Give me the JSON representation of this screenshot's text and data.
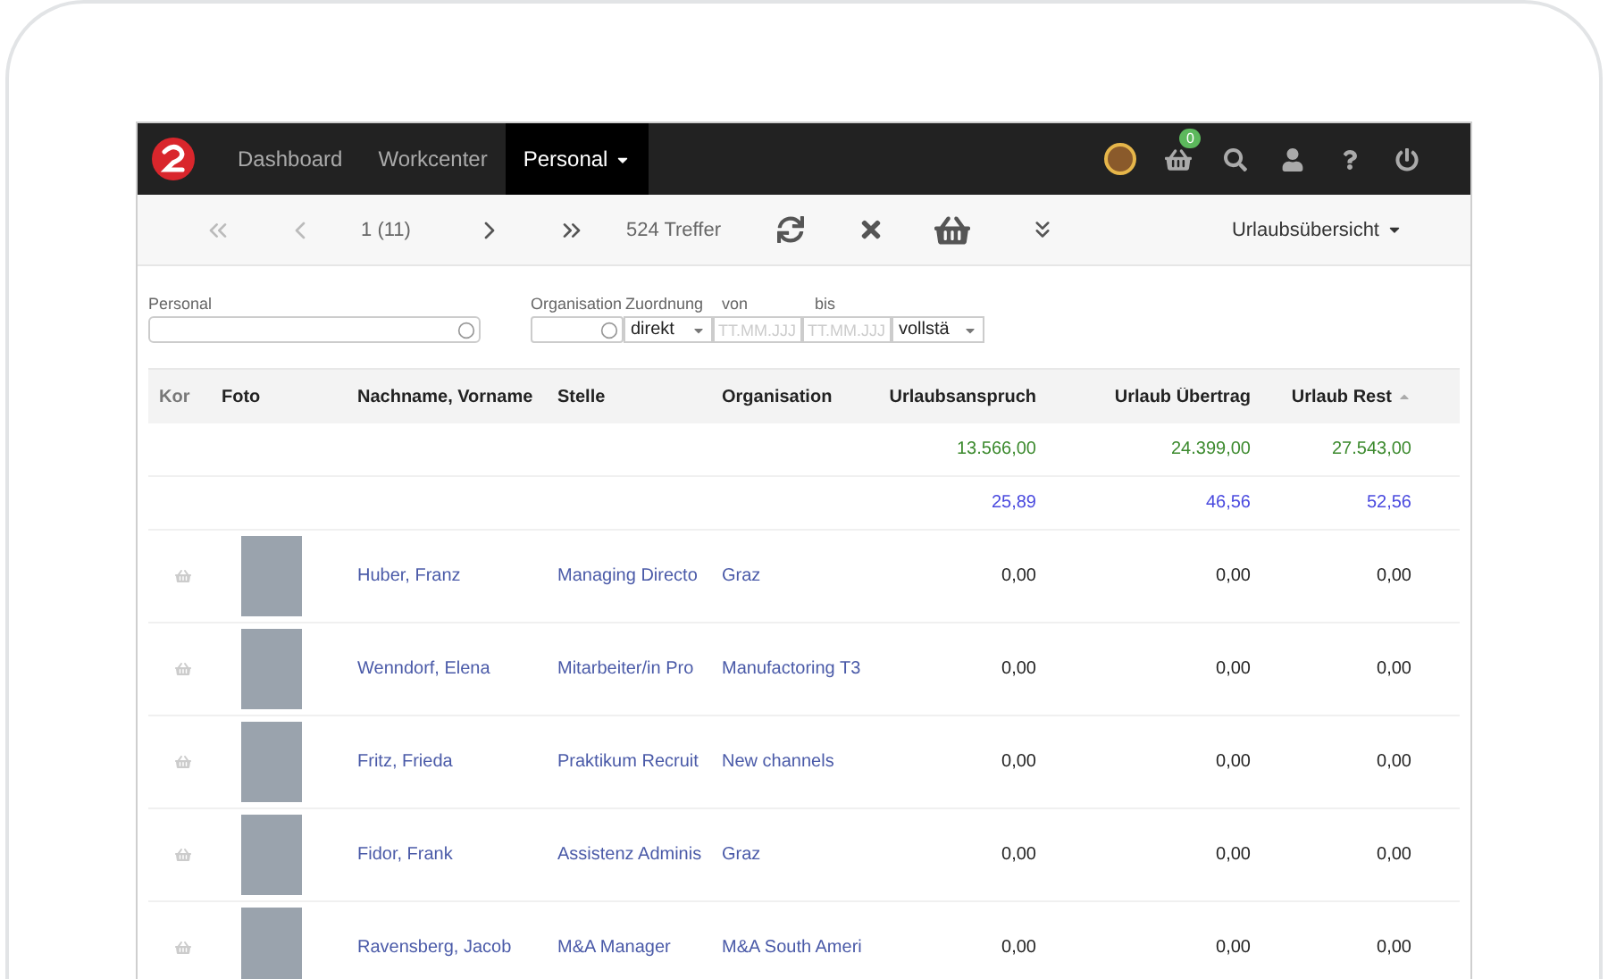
{
  "nav": {
    "items": [
      {
        "label": "Dashboard",
        "selected": false,
        "dropdown": false
      },
      {
        "label": "Workcenter",
        "selected": false,
        "dropdown": false
      },
      {
        "label": "Personal",
        "selected": true,
        "dropdown": true
      }
    ],
    "cart_count": "0"
  },
  "toolbar": {
    "page": "1 (11)",
    "hits": "524 Treffer",
    "view": "Urlaubsübersicht"
  },
  "filters": {
    "personal": {
      "label": "Personal"
    },
    "organisation": {
      "label": "Organisation"
    },
    "zuordnung": {
      "label": "Zuordnung",
      "value": "direkt"
    },
    "von": {
      "label": "von",
      "placeholder": "TT.MM.JJJ"
    },
    "bis": {
      "label": "bis",
      "placeholder": "TT.MM.JJJ"
    },
    "umfang": {
      "value": "vollstä"
    }
  },
  "table": {
    "columns": [
      {
        "label": "Kor",
        "sorted": false
      },
      {
        "label": "Foto",
        "sorted": false
      },
      {
        "label": "Nachname, Vorname",
        "sorted": false
      },
      {
        "label": "Stelle",
        "sorted": false
      },
      {
        "label": "Organisation",
        "sorted": false
      },
      {
        "label": "Urlaubsanspruch",
        "sorted": false
      },
      {
        "label": "Urlaub Übertrag",
        "sorted": false
      },
      {
        "label": "Urlaub Rest",
        "sorted": true
      }
    ],
    "totals": [
      {
        "kind": "sum",
        "values": [
          "13.566,00",
          "24.399,00",
          "27.543,00"
        ]
      },
      {
        "kind": "average",
        "values": [
          "25,89",
          "46,56",
          "52,56"
        ]
      }
    ],
    "rows": [
      {
        "name": "Huber, Franz",
        "position": "Managing Directo",
        "organisation": "Graz",
        "values": [
          "0,00",
          "0,00",
          "0,00"
        ]
      },
      {
        "name": "Wenndorf, Elena",
        "position": "Mitarbeiter/in Pro",
        "organisation": "Manufactoring T3",
        "values": [
          "0,00",
          "0,00",
          "0,00"
        ]
      },
      {
        "name": "Fritz, Frieda",
        "position": "Praktikum Recruit",
        "organisation": "New channels",
        "values": [
          "0,00",
          "0,00",
          "0,00"
        ]
      },
      {
        "name": "Fidor, Frank",
        "position": "Assistenz Adminis",
        "organisation": "Graz",
        "values": [
          "0,00",
          "0,00",
          "0,00"
        ]
      },
      {
        "name": "Ravensberg, Jacob",
        "position": "M&A Manager",
        "organisation": "M&A South Ameri",
        "values": [
          "0,00",
          "0,00",
          "0,00"
        ]
      }
    ]
  }
}
